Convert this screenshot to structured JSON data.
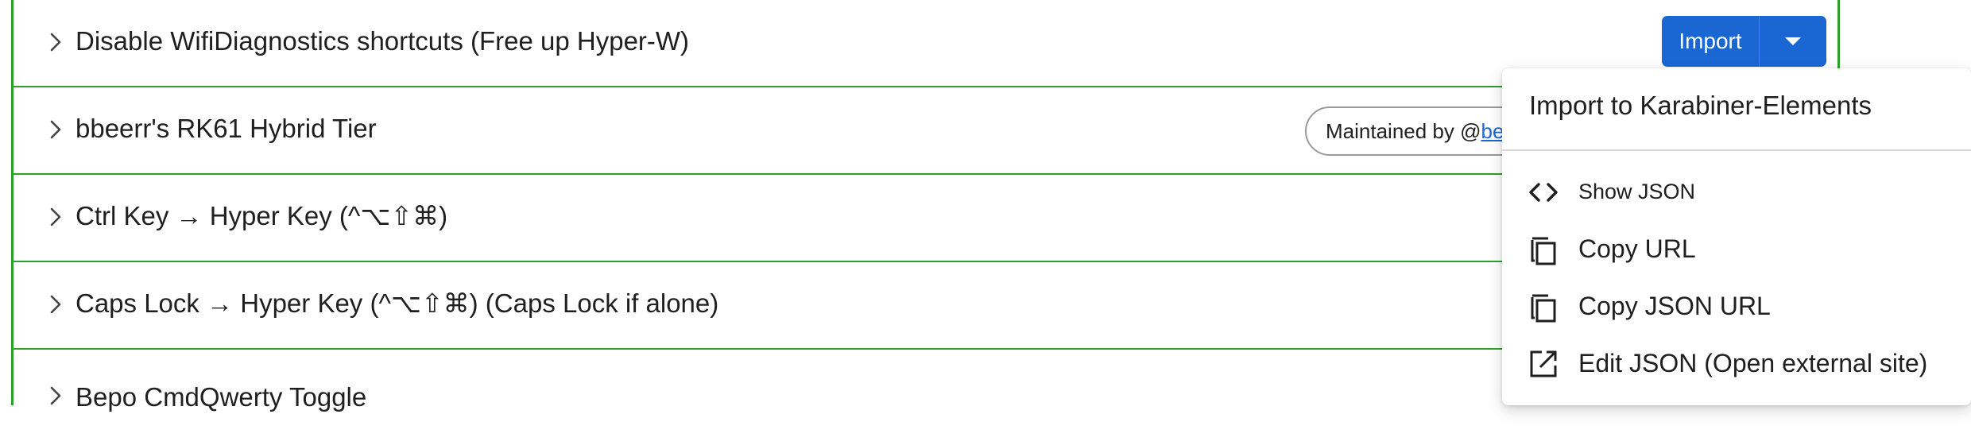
{
  "rows": [
    {
      "title": "Disable WifiDiagnostics shortcuts (Free up Hyper-W)"
    },
    {
      "title": "bbeerr's RK61 Hybrid Tier"
    },
    {
      "title": "Ctrl Key → Hyper Key (^⌥⇧⌘)"
    },
    {
      "title": "Caps Lock → Hyper Key (^⌥⇧⌘) (Caps Lock if alone)"
    },
    {
      "title": "Bepo CmdQwerty Toggle"
    }
  ],
  "import_button": {
    "label": "Import"
  },
  "maintainer_chip": {
    "prefix": "Maintained by @",
    "link": "be"
  },
  "menu": {
    "header": "Import to Karabiner-Elements",
    "items": [
      {
        "label": "Show JSON",
        "icon": "code-icon"
      },
      {
        "label": "Copy URL",
        "icon": "copy-icon"
      },
      {
        "label": "Copy JSON URL",
        "icon": "copy-icon"
      },
      {
        "label": "Edit JSON (Open external site)",
        "icon": "open-external-icon"
      }
    ]
  },
  "colors": {
    "accent": "#1a66d2",
    "border": "#2ba02b"
  }
}
